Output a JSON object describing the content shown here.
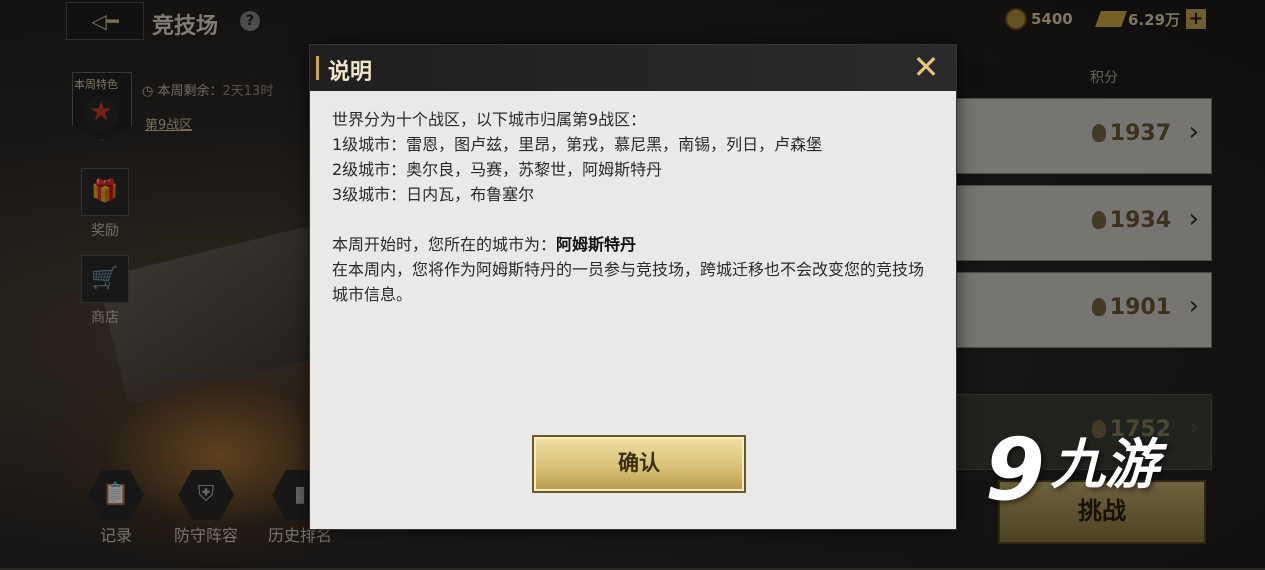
{
  "header": {
    "back_icon": "back-arrow-icon",
    "title": "竞技场",
    "help": "?",
    "badge_value": "5400",
    "gold_value": "6.29万",
    "plus": "+"
  },
  "left_panel": {
    "weekly_label": "本周特色",
    "remain_label": "本周剩余：",
    "remain_value": "2天13时",
    "zone_link": "第9战区",
    "reward_label": "奖励",
    "shop_label": "商店"
  },
  "bottom_nav": {
    "record": "记录",
    "defense": "防守阵容",
    "history": "历史排名"
  },
  "ranking": {
    "header": "积分",
    "rows": [
      {
        "score": "1937"
      },
      {
        "score": "1934"
      },
      {
        "score": "1901"
      },
      {
        "score": "1752"
      }
    ],
    "challenge_label": "挑战"
  },
  "modal": {
    "title": "说明",
    "close": "✕",
    "lines": [
      "世界分为十个战区，以下城市归属第9战区：",
      "1级城市：雷恩，图卢兹，里昂，第戎，慕尼黑，南锡，列日，卢森堡",
      "2级城市：奥尔良，马赛，苏黎世，阿姆斯特丹",
      "3级城市：日内瓦，布鲁塞尔"
    ],
    "city_prefix": "本周开始时，您所在的城市为：",
    "city_name": "阿姆斯特丹",
    "note": "在本周内，您将作为阿姆斯特丹的一员参与竞技场，跨城迁移也不会改变您的竞技场城市信息。",
    "confirm": "确认"
  },
  "watermark": {
    "text": "九游"
  }
}
